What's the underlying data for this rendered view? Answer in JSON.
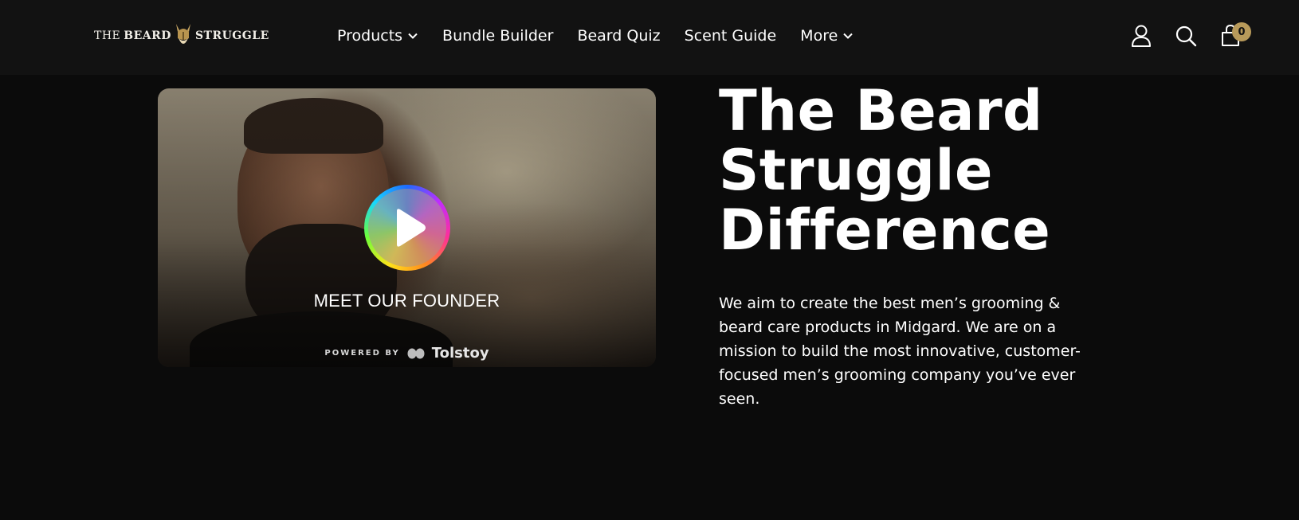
{
  "header": {
    "logo": {
      "pre": "THE",
      "word1": "BEARD",
      "word2": "STRUGGLE"
    },
    "nav": [
      {
        "label": "Products",
        "dropdown": true
      },
      {
        "label": "Bundle Builder",
        "dropdown": false
      },
      {
        "label": "Beard Quiz",
        "dropdown": false
      },
      {
        "label": "Scent Guide",
        "dropdown": false
      },
      {
        "label": "More",
        "dropdown": true
      }
    ],
    "icons": [
      "account-icon",
      "search-icon",
      "cart-icon"
    ],
    "cart_count": "0"
  },
  "video": {
    "label": "MEET OUR FOUNDER",
    "powered_by": "POWERED BY",
    "brand": "Tolstoy"
  },
  "hero": {
    "headline_lines": [
      "The Beard",
      "Struggle",
      "Difference"
    ],
    "body": "We aim to create the best men’s grooming & beard care products in Midgard. We are on a mission to build the most innovative, customer-focused men’s grooming company you’ve ever seen."
  },
  "colors": {
    "background": "#0b0b0b",
    "header_bg": "#121212",
    "text": "#ffffff",
    "accent_gold": "#b89a5a"
  }
}
